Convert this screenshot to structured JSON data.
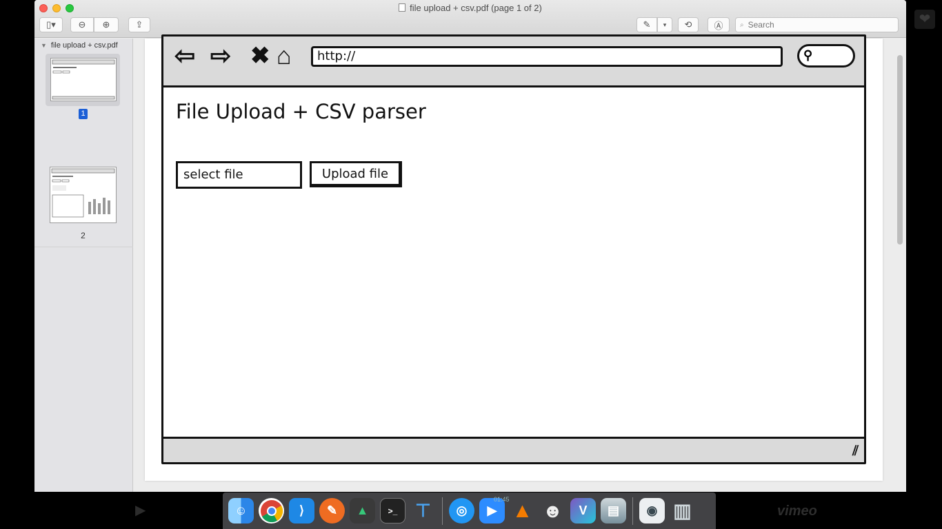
{
  "window": {
    "title": "file upload + csv.pdf (page 1 of 2)",
    "search_placeholder": "Search"
  },
  "toolbar": {
    "sidebar_glyph": "▯▾",
    "zoom_out_glyph": "⊖",
    "zoom_in_glyph": "⊕",
    "share_glyph": "⇪",
    "markup_glyph": "✎",
    "markup_dropdown_glyph": "▾",
    "rotate_glyph": "⟲",
    "annotate_glyph": "Ⓐ",
    "search_glyph": "🔍"
  },
  "sidebar": {
    "document_name": "file upload + csv.pdf",
    "pages": [
      {
        "number": "1",
        "selected": true
      },
      {
        "number": "2",
        "selected": false
      }
    ]
  },
  "mockup": {
    "url_text": "http://",
    "page_title": "File Upload + CSV parser",
    "select_file_label": "select file",
    "upload_button_label": "Upload file",
    "nav_icons": [
      "back-arrow-icon",
      "forward-arrow-icon",
      "close-x-icon",
      "home-icon"
    ]
  },
  "dock": {
    "apps": [
      "finder",
      "chrome",
      "vscode",
      "postman",
      "gitkraken",
      "terminal",
      "keynote",
      "quicktime",
      "zoom",
      "vlc",
      "character-viewer",
      "affinity",
      "preview",
      "quicktime-recording",
      "trash"
    ],
    "time_label": "01:45"
  },
  "video_overlay": {
    "brand": "vimeo"
  }
}
